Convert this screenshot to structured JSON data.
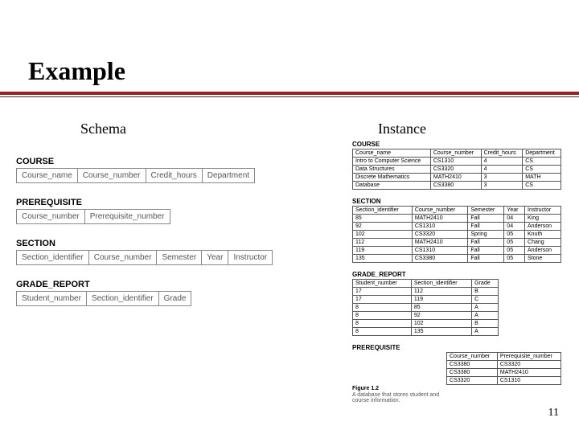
{
  "title": "Example",
  "subheads": {
    "schema": "Schema",
    "instance": "Instance"
  },
  "page_number": "11",
  "schema": [
    {
      "name": "COURSE",
      "cols": [
        "Course_name",
        "Course_number",
        "Credit_hours",
        "Department"
      ]
    },
    {
      "name": "PREREQUISITE",
      "cols": [
        "Course_number",
        "Prerequisite_number"
      ]
    },
    {
      "name": "SECTION",
      "cols": [
        "Section_identifier",
        "Course_number",
        "Semester",
        "Year",
        "Instructor"
      ]
    },
    {
      "name": "GRADE_REPORT",
      "cols": [
        "Student_number",
        "Section_identifier",
        "Grade"
      ]
    }
  ],
  "instance": {
    "course": {
      "name": "COURSE",
      "headers": [
        "Course_name",
        "Course_number",
        "Credit_hours",
        "Department"
      ],
      "rows": [
        [
          "Intro to Computer Science",
          "CS1310",
          "4",
          "CS"
        ],
        [
          "Data Structures",
          "CS3320",
          "4",
          "CS"
        ],
        [
          "Discrete Mathematics",
          "MATH2410",
          "3",
          "MATH"
        ],
        [
          "Database",
          "CS3380",
          "3",
          "CS"
        ]
      ]
    },
    "section": {
      "name": "SECTION",
      "headers": [
        "Section_identifier",
        "Course_number",
        "Semester",
        "Year",
        "Instructor"
      ],
      "rows": [
        [
          "85",
          "MATH2410",
          "Fall",
          "04",
          "King"
        ],
        [
          "92",
          "CS1310",
          "Fall",
          "04",
          "Anderson"
        ],
        [
          "102",
          "CS3320",
          "Spring",
          "05",
          "Knuth"
        ],
        [
          "112",
          "MATH2410",
          "Fall",
          "05",
          "Chang"
        ],
        [
          "119",
          "CS1310",
          "Fall",
          "05",
          "Anderson"
        ],
        [
          "135",
          "CS3380",
          "Fall",
          "05",
          "Stone"
        ]
      ]
    },
    "grade_report": {
      "name": "GRADE_REPORT",
      "headers": [
        "Student_number",
        "Section_identifier",
        "Grade"
      ],
      "rows": [
        [
          "17",
          "112",
          "B"
        ],
        [
          "17",
          "119",
          "C"
        ],
        [
          "8",
          "85",
          "A"
        ],
        [
          "8",
          "92",
          "A"
        ],
        [
          "8",
          "102",
          "B"
        ],
        [
          "8",
          "135",
          "A"
        ]
      ]
    },
    "prerequisite": {
      "name": "PREREQUISITE",
      "headers": [
        "Course_number",
        "Prerequisite_number"
      ],
      "rows": [
        [
          "CS3380",
          "CS3320"
        ],
        [
          "CS3380",
          "MATH2410"
        ],
        [
          "CS3320",
          "CS1310"
        ]
      ]
    }
  },
  "figure_caption": {
    "label": "Figure 1.2",
    "text": "A database that stores student and course information."
  }
}
